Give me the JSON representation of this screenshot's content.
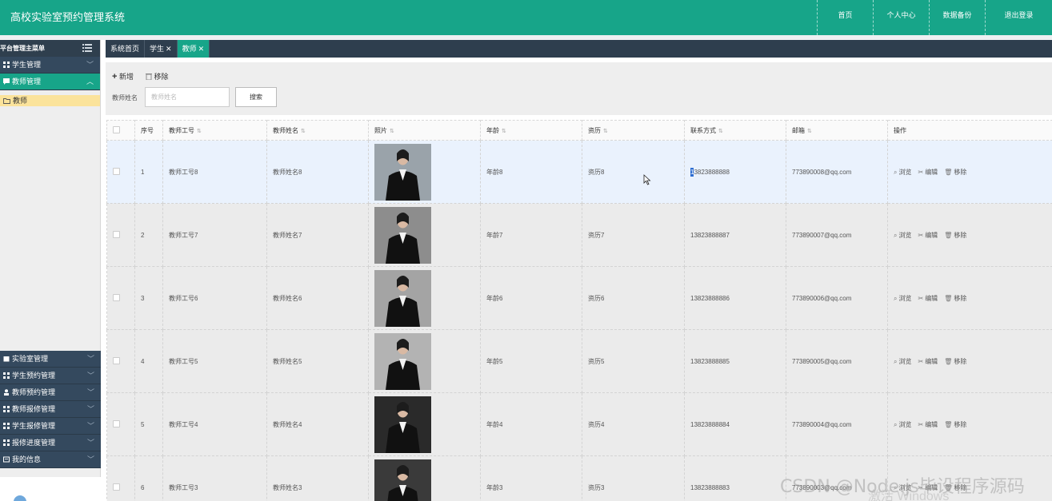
{
  "header": {
    "title": "高校实验室预约管理系统",
    "nav": [
      "首页",
      "个人中心",
      "数据备份",
      "退出登录"
    ]
  },
  "sidebar": {
    "head": "平台管理主菜单",
    "menus_top": [
      {
        "label": "学生管理",
        "active": false
      },
      {
        "label": "教师管理",
        "active": true
      }
    ],
    "submenu": "教师",
    "menus_bottom": [
      {
        "label": "实验室管理"
      },
      {
        "label": "学生预约管理"
      },
      {
        "label": "教师预约管理"
      },
      {
        "label": "教师报修管理"
      },
      {
        "label": "学生报修管理"
      },
      {
        "label": "报修进度管理"
      },
      {
        "label": "我的信息"
      }
    ]
  },
  "tabs": [
    {
      "label": "系统首页",
      "closable": false
    },
    {
      "label": "学生",
      "closable": true
    },
    {
      "label": "教师",
      "closable": true,
      "active": true
    }
  ],
  "toolbar": {
    "add_label": "新增",
    "remove_label": "移除",
    "search_label": "教师姓名",
    "search_placeholder": "教师姓名",
    "search_button": "搜索"
  },
  "table": {
    "columns": [
      "序号",
      "教师工号",
      "教师姓名",
      "照片",
      "年龄",
      "资历",
      "联系方式",
      "邮箱",
      "操作"
    ],
    "rows": [
      {
        "no": "1",
        "id": "教师工号8",
        "name": "教师姓名8",
        "age": "年龄8",
        "exp": "资历8",
        "phone_hl": "1",
        "phone": "3823888888",
        "email": "773890008@qq.com",
        "photo_bg": "#9aa3aa"
      },
      {
        "no": "2",
        "id": "教师工号7",
        "name": "教师姓名7",
        "age": "年龄7",
        "exp": "资历7",
        "phone_hl": "",
        "phone": "13823888887",
        "email": "773890007@qq.com",
        "photo_bg": "#8d8d8d"
      },
      {
        "no": "3",
        "id": "教师工号6",
        "name": "教师姓名6",
        "age": "年龄6",
        "exp": "资历6",
        "phone_hl": "",
        "phone": "13823888886",
        "email": "773890006@qq.com",
        "photo_bg": "#a4a4a4"
      },
      {
        "no": "4",
        "id": "教师工号5",
        "name": "教师姓名5",
        "age": "年龄5",
        "exp": "资历5",
        "phone_hl": "",
        "phone": "13823888885",
        "email": "773890005@qq.com",
        "photo_bg": "#b3b3b3"
      },
      {
        "no": "5",
        "id": "教师工号4",
        "name": "教师姓名4",
        "age": "年龄4",
        "exp": "资历4",
        "phone_hl": "",
        "phone": "13823888884",
        "email": "773890004@qq.com",
        "photo_bg": "#2a2a2a"
      },
      {
        "no": "6",
        "id": "教师工号3",
        "name": "教师姓名3",
        "age": "年龄3",
        "exp": "资历3",
        "phone_hl": "",
        "phone": "13823888883",
        "email": "773890003@qq.com",
        "photo_bg": "#3a3a3a"
      }
    ],
    "ops": [
      "浏览",
      "编辑",
      "移除"
    ]
  },
  "watermark": "CSDN @Node.js毕设程序源码",
  "watermark2": "激活 Windows",
  "colors": {
    "brand": "#17a589",
    "dark": "#2e3e4e",
    "highlight": "#fbe39b",
    "selected_row": "#eaf2fd"
  }
}
